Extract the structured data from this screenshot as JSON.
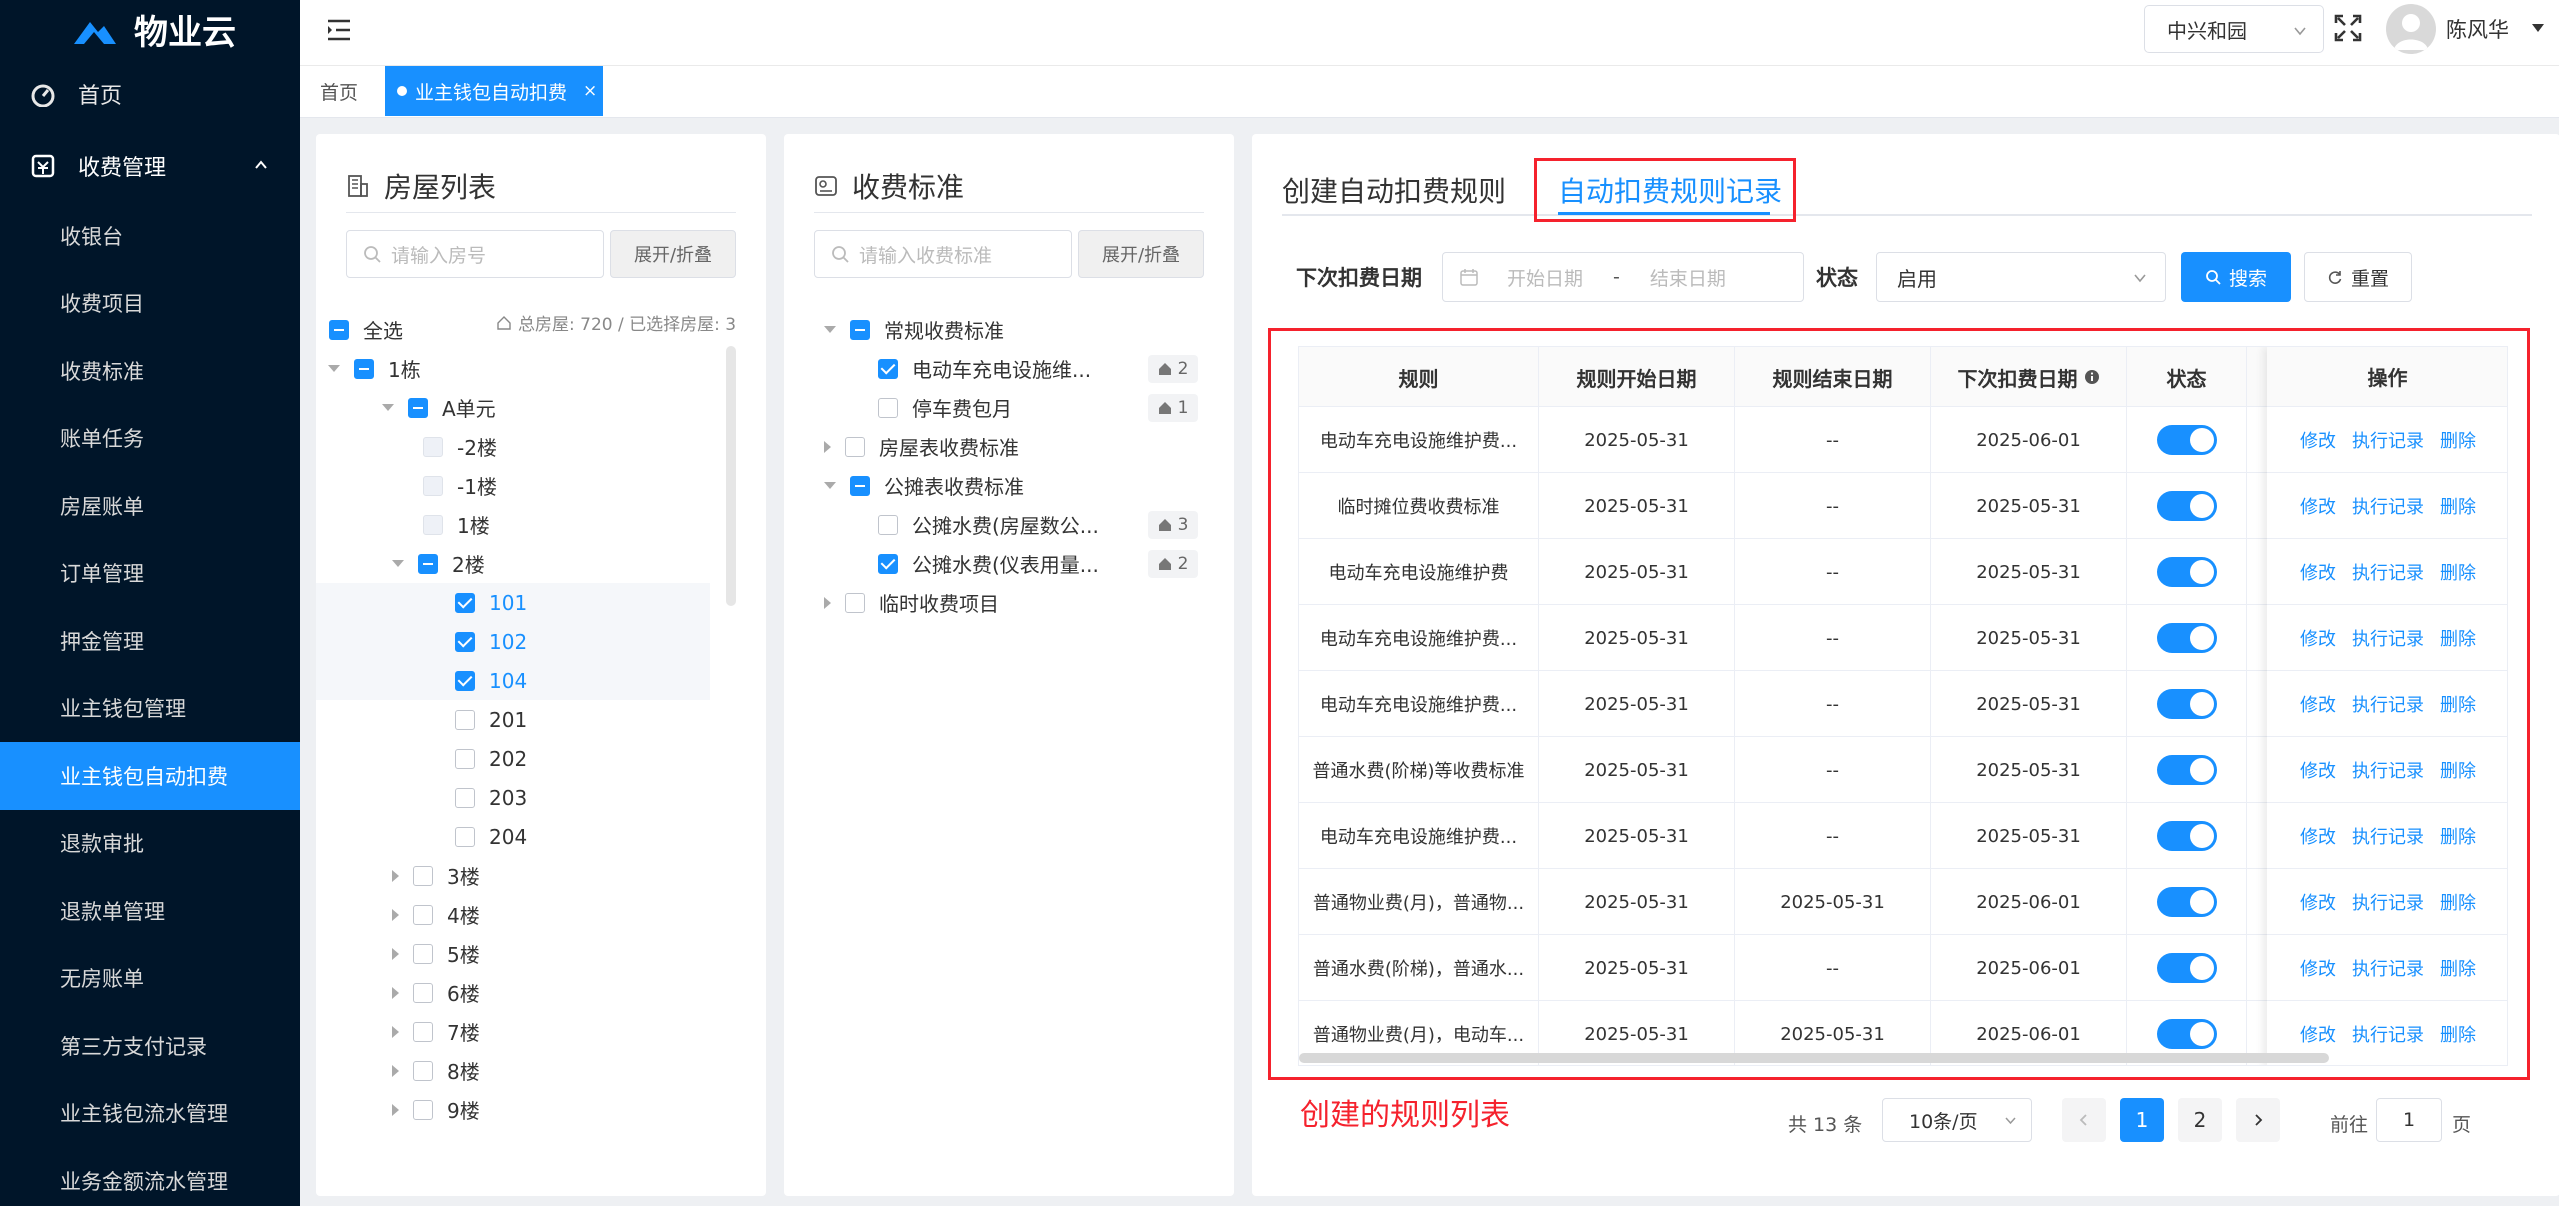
{
  "app": {
    "title": "物业云"
  },
  "sidebar": {
    "home": "首页",
    "group": "收费管理",
    "items": [
      "收银台",
      "收费项目",
      "收费标准",
      "账单任务",
      "房屋账单",
      "订单管理",
      "押金管理",
      "业主钱包管理",
      "业主钱包自动扣费",
      "退款审批",
      "退款单管理",
      "无房账单",
      "第三方支付记录",
      "业主钱包流水管理",
      "业务金额流水管理"
    ],
    "active_index": 8
  },
  "header": {
    "org": "中兴和园",
    "user": "陈风华"
  },
  "tabs": {
    "home": "首页",
    "active": "业主钱包自动扣费",
    "close": "×"
  },
  "house_panel": {
    "title": "房屋列表",
    "search_placeholder": "请输入房号",
    "toggle": "展开/折叠",
    "select_all": "全选",
    "summary": "总房屋: 720 / 已选择房屋: 3",
    "building": "1栋",
    "unit": "A单元",
    "floors_disabled": [
      "-2楼",
      "-1楼",
      "1楼"
    ],
    "floor_open": "2楼",
    "rooms": [
      {
        "name": "101",
        "checked": true
      },
      {
        "name": "102",
        "checked": true
      },
      {
        "name": "104",
        "checked": true
      },
      {
        "name": "201",
        "checked": false
      },
      {
        "name": "202",
        "checked": false
      },
      {
        "name": "203",
        "checked": false
      },
      {
        "name": "204",
        "checked": false
      }
    ],
    "floors_closed": [
      "3楼",
      "4楼",
      "5楼",
      "6楼",
      "7楼",
      "8楼",
      "9楼"
    ]
  },
  "std_panel": {
    "title": "收费标准",
    "search_placeholder": "请输入收费标准",
    "toggle": "展开/折叠",
    "groups": [
      {
        "name": "常规收费标准",
        "open": true,
        "state": "ind",
        "items": [
          {
            "name": "电动车充电设施维...",
            "checked": true,
            "count": "2"
          },
          {
            "name": "停车费包月",
            "checked": false,
            "count": "1"
          }
        ]
      },
      {
        "name": "房屋表收费标准",
        "open": false,
        "state": "none",
        "items": []
      },
      {
        "name": "公摊表收费标准",
        "open": true,
        "state": "ind",
        "items": [
          {
            "name": "公摊水费(房屋数公...",
            "checked": false,
            "count": "3"
          },
          {
            "name": "公摊水费(仪表用量...",
            "checked": true,
            "count": "2"
          }
        ]
      },
      {
        "name": "临时收费项目",
        "open": false,
        "state": "none",
        "items": []
      }
    ]
  },
  "rule_panel": {
    "tab_create": "创建自动扣费规则",
    "tab_records": "自动扣费规则记录",
    "filter": {
      "next_date_label": "下次扣费日期",
      "start_placeholder": "开始日期",
      "sep": "-",
      "end_placeholder": "结束日期",
      "status_label": "状态",
      "status_value": "启用",
      "search": "搜索",
      "reset": "重置"
    },
    "columns": [
      "规则",
      "规则开始日期",
      "规则结束日期",
      "下次扣费日期",
      "状态",
      "操作"
    ],
    "ops": [
      "修改",
      "执行记录",
      "删除"
    ],
    "rows": [
      {
        "rule": "电动车充电设施维护费...",
        "start": "2025-05-31",
        "end": "--",
        "next": "2025-06-01"
      },
      {
        "rule": "临时摊位费收费标准",
        "start": "2025-05-31",
        "end": "--",
        "next": "2025-05-31"
      },
      {
        "rule": "电动车充电设施维护费",
        "start": "2025-05-31",
        "end": "--",
        "next": "2025-05-31"
      },
      {
        "rule": "电动车充电设施维护费...",
        "start": "2025-05-31",
        "end": "--",
        "next": "2025-05-31"
      },
      {
        "rule": "电动车充电设施维护费...",
        "start": "2025-05-31",
        "end": "--",
        "next": "2025-05-31"
      },
      {
        "rule": "普通水费(阶梯)等收费标准",
        "start": "2025-05-31",
        "end": "--",
        "next": "2025-05-31"
      },
      {
        "rule": "电动车充电设施维护费...",
        "start": "2025-05-31",
        "end": "--",
        "next": "2025-05-31"
      },
      {
        "rule": "普通物业费(月)，普通物...",
        "start": "2025-05-31",
        "end": "2025-05-31",
        "next": "2025-06-01"
      },
      {
        "rule": "普通水费(阶梯)，普通水...",
        "start": "2025-05-31",
        "end": "--",
        "next": "2025-06-01"
      },
      {
        "rule": "普通物业费(月)，电动车...",
        "start": "2025-05-31",
        "end": "2025-05-31",
        "next": "2025-06-01"
      }
    ],
    "caption": "创建的规则列表",
    "pager": {
      "total": "共 13 条",
      "size": "10条/页",
      "pages": [
        "1",
        "2"
      ],
      "current": "1",
      "goto_label": "前往",
      "goto_value": "1",
      "page_unit": "页"
    }
  },
  "colors": {
    "primary": "#1890ff",
    "sidebar_bg": "#001529",
    "annotation": "#f5222d"
  }
}
